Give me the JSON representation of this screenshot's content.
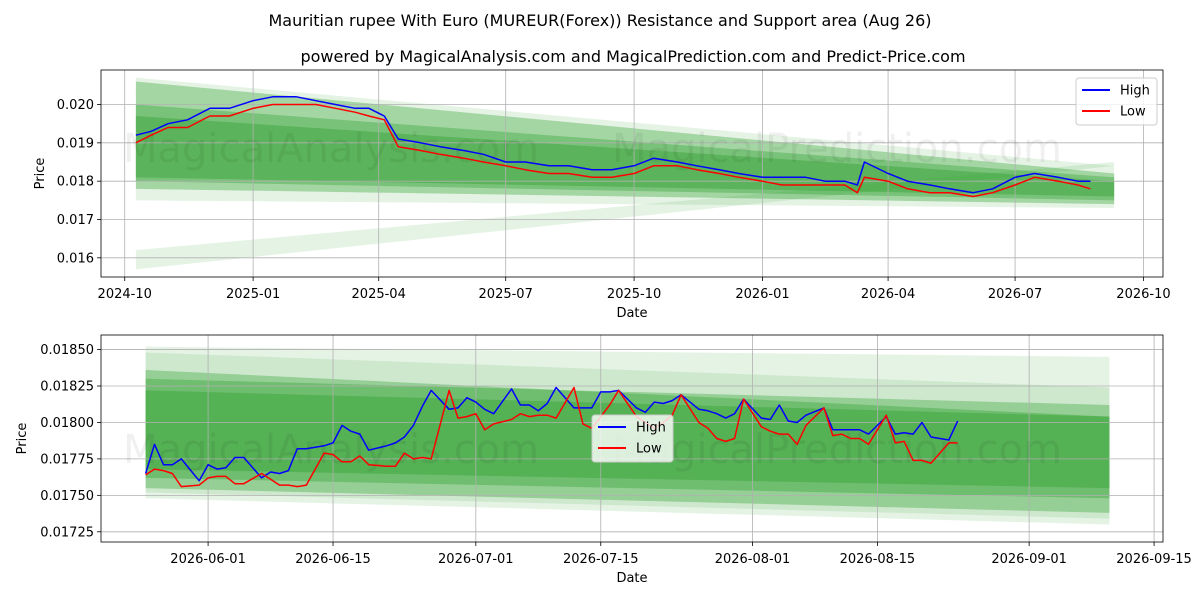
{
  "title": "Mauritian rupee With Euro (MUREUR(Forex)) Resistance and Support area (Aug 26)",
  "subtitle": "powered by MagicalAnalysis.com and MagicalPrediction.com and Predict-Price.com",
  "watermarks": [
    "MagicalAnalysis.com",
    "MagicalPrediction.com"
  ],
  "colors": {
    "high": "#0000ff",
    "low": "#ff0000",
    "band": "#2ca02c",
    "grid": "#b0b0b0"
  },
  "chart_data": [
    {
      "type": "line",
      "xlabel": "Date",
      "ylabel": "Price",
      "xlim": [
        "2024-09-14",
        "2026-10-15"
      ],
      "ylim": [
        0.0155,
        0.0209
      ],
      "x_ticks": [
        "2024-10",
        "2025-01",
        "2025-04",
        "2025-07",
        "2025-10",
        "2026-01",
        "2026-04",
        "2026-07",
        "2026-10"
      ],
      "y_ticks": [
        "0.016",
        "0.017",
        "0.018",
        "0.019",
        "0.020"
      ],
      "legend": {
        "position": "top-right",
        "entries": [
          "High",
          "Low"
        ]
      },
      "grid": true,
      "series": [
        {
          "name": "High",
          "x": [
            "2024-10-09",
            "2024-10-20",
            "2024-11-01",
            "2024-11-15",
            "2024-12-01",
            "2024-12-15",
            "2025-01-01",
            "2025-01-15",
            "2025-02-01",
            "2025-02-15",
            "2025-03-01",
            "2025-03-15",
            "2025-03-25",
            "2025-04-05",
            "2025-04-15",
            "2025-05-01",
            "2025-05-15",
            "2025-06-01",
            "2025-06-15",
            "2025-07-01",
            "2025-07-15",
            "2025-08-01",
            "2025-08-15",
            "2025-09-01",
            "2025-09-15",
            "2025-10-01",
            "2025-10-15",
            "2025-11-01",
            "2025-11-15",
            "2025-12-01",
            "2025-12-15",
            "2026-01-01",
            "2026-01-15",
            "2026-02-01",
            "2026-02-15",
            "2026-03-01",
            "2026-03-10",
            "2026-03-15",
            "2026-04-01",
            "2026-04-15",
            "2026-05-01",
            "2026-05-15",
            "2026-06-01",
            "2026-06-15",
            "2026-07-01",
            "2026-07-15",
            "2026-08-01",
            "2026-08-15",
            "2026-08-24"
          ],
          "values": [
            0.0192,
            0.0193,
            0.0195,
            0.0196,
            0.0199,
            0.0199,
            0.0201,
            0.0202,
            0.0202,
            0.0201,
            0.02,
            0.0199,
            0.0199,
            0.0197,
            0.0191,
            0.019,
            0.0189,
            0.0188,
            0.0187,
            0.0185,
            0.0185,
            0.0184,
            0.0184,
            0.0183,
            0.0183,
            0.0184,
            0.0186,
            0.0185,
            0.0184,
            0.0183,
            0.0182,
            0.0181,
            0.0181,
            0.0181,
            0.018,
            0.018,
            0.0179,
            0.0185,
            0.0182,
            0.018,
            0.0179,
            0.0178,
            0.0177,
            0.0178,
            0.0181,
            0.0182,
            0.0181,
            0.018,
            0.018
          ]
        },
        {
          "name": "Low",
          "x": [
            "2024-10-09",
            "2024-10-20",
            "2024-11-01",
            "2024-11-15",
            "2024-12-01",
            "2024-12-15",
            "2025-01-01",
            "2025-01-15",
            "2025-02-01",
            "2025-02-15",
            "2025-03-01",
            "2025-03-15",
            "2025-03-25",
            "2025-04-05",
            "2025-04-15",
            "2025-05-01",
            "2025-05-15",
            "2025-06-01",
            "2025-06-15",
            "2025-07-01",
            "2025-07-15",
            "2025-08-01",
            "2025-08-15",
            "2025-09-01",
            "2025-09-15",
            "2025-10-01",
            "2025-10-15",
            "2025-11-01",
            "2025-11-15",
            "2025-12-01",
            "2025-12-15",
            "2026-01-01",
            "2026-01-15",
            "2026-02-01",
            "2026-02-15",
            "2026-03-01",
            "2026-03-10",
            "2026-03-15",
            "2026-04-01",
            "2026-04-15",
            "2026-05-01",
            "2026-05-15",
            "2026-06-01",
            "2026-06-15",
            "2026-07-01",
            "2026-07-15",
            "2026-08-01",
            "2026-08-15",
            "2026-08-24"
          ],
          "values": [
            0.019,
            0.0192,
            0.0194,
            0.0194,
            0.0197,
            0.0197,
            0.0199,
            0.02,
            0.02,
            0.02,
            0.0199,
            0.0198,
            0.0197,
            0.0196,
            0.0189,
            0.0188,
            0.0187,
            0.0186,
            0.0185,
            0.0184,
            0.0183,
            0.0182,
            0.0182,
            0.0181,
            0.0181,
            0.0182,
            0.0184,
            0.0184,
            0.0183,
            0.0182,
            0.0181,
            0.018,
            0.0179,
            0.0179,
            0.0179,
            0.0179,
            0.0177,
            0.0181,
            0.018,
            0.0178,
            0.0177,
            0.0177,
            0.0176,
            0.0177,
            0.0179,
            0.0181,
            0.018,
            0.0179,
            0.0178
          ]
        }
      ],
      "bands": [
        {
          "x": [
            "2024-10-09",
            "2026-09-10"
          ],
          "upper": [
            0.0206,
            0.0182
          ],
          "lower": [
            0.0178,
            0.0174
          ],
          "opacity": 0.35
        },
        {
          "x": [
            "2024-10-09",
            "2026-09-10"
          ],
          "upper": [
            0.02,
            0.0181
          ],
          "lower": [
            0.018,
            0.0175
          ],
          "opacity": 0.35
        },
        {
          "x": [
            "2024-10-09",
            "2026-09-10"
          ],
          "upper": [
            0.0197,
            0.018
          ],
          "lower": [
            0.0181,
            0.0176
          ],
          "opacity": 0.4
        },
        {
          "x": [
            "2024-10-09",
            "2026-09-10"
          ],
          "upper": [
            0.0207,
            0.0184
          ],
          "lower": [
            0.0175,
            0.0173
          ],
          "opacity": 0.12
        },
        {
          "x": [
            "2024-10-09",
            "2026-09-10"
          ],
          "upper": [
            0.0162,
            0.0185
          ],
          "lower": [
            0.0157,
            0.0184
          ],
          "opacity": 0.12
        }
      ]
    },
    {
      "type": "line",
      "xlabel": "Date",
      "ylabel": "Price",
      "xlim": [
        "2026-05-20",
        "2026-09-16"
      ],
      "ylim": [
        0.01718,
        0.0186
      ],
      "x_ticks": [
        "2026-06-01",
        "2026-06-15",
        "2026-07-01",
        "2026-07-15",
        "2026-08-01",
        "2026-08-15",
        "2026-09-01",
        "2026-09-15"
      ],
      "y_ticks": [
        "0.01725",
        "0.01750",
        "0.01775",
        "0.01800",
        "0.01825",
        "0.01850"
      ],
      "legend": {
        "position": "center",
        "entries": [
          "High",
          "Low"
        ]
      },
      "grid": true,
      "series": [
        {
          "name": "High",
          "x": [
            "2026-05-25",
            "2026-05-26",
            "2026-05-27",
            "2026-05-28",
            "2026-05-29",
            "2026-05-31",
            "2026-06-01",
            "2026-06-02",
            "2026-06-03",
            "2026-06-04",
            "2026-06-05",
            "2026-06-07",
            "2026-06-08",
            "2026-06-09",
            "2026-06-10",
            "2026-06-11",
            "2026-06-12",
            "2026-06-14",
            "2026-06-15",
            "2026-06-16",
            "2026-06-17",
            "2026-06-18",
            "2026-06-19",
            "2026-06-21",
            "2026-06-22",
            "2026-06-23",
            "2026-06-24",
            "2026-06-25",
            "2026-06-26",
            "2026-06-28",
            "2026-06-29",
            "2026-06-30",
            "2026-07-01",
            "2026-07-02",
            "2026-07-03",
            "2026-07-05",
            "2026-07-06",
            "2026-07-07",
            "2026-07-08",
            "2026-07-09",
            "2026-07-10",
            "2026-07-12",
            "2026-07-13",
            "2026-07-14",
            "2026-07-15",
            "2026-07-16",
            "2026-07-17",
            "2026-07-19",
            "2026-07-20",
            "2026-07-21",
            "2026-07-22",
            "2026-07-23",
            "2026-07-24",
            "2026-07-26",
            "2026-07-27",
            "2026-07-28",
            "2026-07-29",
            "2026-07-30",
            "2026-07-31",
            "2026-08-02",
            "2026-08-03",
            "2026-08-04",
            "2026-08-05",
            "2026-08-06",
            "2026-08-07",
            "2026-08-09",
            "2026-08-10",
            "2026-08-11",
            "2026-08-12",
            "2026-08-13",
            "2026-08-14",
            "2026-08-16",
            "2026-08-17",
            "2026-08-18",
            "2026-08-19",
            "2026-08-20",
            "2026-08-21",
            "2026-08-23",
            "2026-08-24"
          ],
          "values": [
            0.01765,
            0.01785,
            0.01771,
            0.01771,
            0.01775,
            0.0176,
            0.01771,
            0.01768,
            0.01769,
            0.01776,
            0.01776,
            0.01762,
            0.01766,
            0.01765,
            0.01767,
            0.01782,
            0.01782,
            0.01784,
            0.01786,
            0.01798,
            0.01794,
            0.01792,
            0.01781,
            0.01784,
            0.01786,
            0.0179,
            0.01798,
            0.01811,
            0.01822,
            0.01809,
            0.0181,
            0.01817,
            0.01814,
            0.01809,
            0.01806,
            0.01823,
            0.01812,
            0.01812,
            0.01808,
            0.01813,
            0.01824,
            0.0181,
            0.0181,
            0.0181,
            0.01821,
            0.01821,
            0.01822,
            0.0181,
            0.01807,
            0.01814,
            0.01813,
            0.01815,
            0.01819,
            0.01809,
            0.01808,
            0.01806,
            0.01803,
            0.01806,
            0.01816,
            0.01803,
            0.01802,
            0.01812,
            0.01801,
            0.018,
            0.01805,
            0.0181,
            0.01795,
            0.01795,
            0.01795,
            0.01795,
            0.01792,
            0.01804,
            0.01792,
            0.01793,
            0.01792,
            0.018,
            0.0179,
            0.01788,
            0.01801
          ]
        },
        {
          "name": "Low",
          "x": [
            "2026-05-25",
            "2026-05-26",
            "2026-05-27",
            "2026-05-28",
            "2026-05-29",
            "2026-05-31",
            "2026-06-01",
            "2026-06-02",
            "2026-06-03",
            "2026-06-04",
            "2026-06-05",
            "2026-06-07",
            "2026-06-08",
            "2026-06-09",
            "2026-06-10",
            "2026-06-11",
            "2026-06-12",
            "2026-06-14",
            "2026-06-15",
            "2026-06-16",
            "2026-06-17",
            "2026-06-18",
            "2026-06-19",
            "2026-06-21",
            "2026-06-22",
            "2026-06-23",
            "2026-06-24",
            "2026-06-25",
            "2026-06-26",
            "2026-06-28",
            "2026-06-29",
            "2026-06-30",
            "2026-07-01",
            "2026-07-02",
            "2026-07-03",
            "2026-07-05",
            "2026-07-06",
            "2026-07-07",
            "2026-07-08",
            "2026-07-09",
            "2026-07-10",
            "2026-07-12",
            "2026-07-13",
            "2026-07-14",
            "2026-07-15",
            "2026-07-16",
            "2026-07-17",
            "2026-07-19",
            "2026-07-20",
            "2026-07-21",
            "2026-07-22",
            "2026-07-23",
            "2026-07-24",
            "2026-07-26",
            "2026-07-27",
            "2026-07-28",
            "2026-07-29",
            "2026-07-30",
            "2026-07-31",
            "2026-08-02",
            "2026-08-03",
            "2026-08-04",
            "2026-08-05",
            "2026-08-06",
            "2026-08-07",
            "2026-08-09",
            "2026-08-10",
            "2026-08-11",
            "2026-08-12",
            "2026-08-13",
            "2026-08-14",
            "2026-08-16",
            "2026-08-17",
            "2026-08-18",
            "2026-08-19",
            "2026-08-20",
            "2026-08-21",
            "2026-08-23",
            "2026-08-24"
          ],
          "values": [
            0.01764,
            0.01768,
            0.01767,
            0.01765,
            0.01756,
            0.01757,
            0.01762,
            0.01763,
            0.01763,
            0.01758,
            0.01758,
            0.01765,
            0.01761,
            0.01757,
            0.01757,
            0.01756,
            0.01757,
            0.01779,
            0.01778,
            0.01773,
            0.01773,
            0.01777,
            0.01771,
            0.0177,
            0.0177,
            0.01779,
            0.01775,
            0.01776,
            0.01775,
            0.01822,
            0.01803,
            0.01804,
            0.01806,
            0.01795,
            0.01799,
            0.01802,
            0.01806,
            0.01804,
            0.01805,
            0.01805,
            0.01803,
            0.01824,
            0.01799,
            0.01796,
            0.01804,
            0.01812,
            0.01822,
            0.01804,
            0.018,
            0.01796,
            0.018,
            0.01805,
            0.01819,
            0.018,
            0.01796,
            0.01789,
            0.01787,
            0.01789,
            0.01816,
            0.01797,
            0.01794,
            0.01792,
            0.01792,
            0.01785,
            0.01798,
            0.0181,
            0.01791,
            0.01792,
            0.01789,
            0.01789,
            0.01785,
            0.01805,
            0.01786,
            0.01787,
            0.01774,
            0.01774,
            0.01772,
            0.01786,
            0.01786
          ]
        }
      ],
      "bands": [
        {
          "x": [
            "2026-05-25",
            "2026-09-10"
          ],
          "upper": [
            0.01836,
            0.01804
          ],
          "lower": [
            0.01755,
            0.01738
          ],
          "opacity": 0.35
        },
        {
          "x": [
            "2026-05-25",
            "2026-09-10"
          ],
          "upper": [
            0.0183,
            0.01812
          ],
          "lower": [
            0.01762,
            0.01748
          ],
          "opacity": 0.35
        },
        {
          "x": [
            "2026-05-25",
            "2026-09-10"
          ],
          "upper": [
            0.01822,
            0.01804
          ],
          "lower": [
            0.01768,
            0.01755
          ],
          "opacity": 0.4
        },
        {
          "x": [
            "2026-05-25",
            "2026-09-10"
          ],
          "upper": [
            0.01852,
            0.01845
          ],
          "lower": [
            0.01748,
            0.0173
          ],
          "opacity": 0.12
        },
        {
          "x": [
            "2026-05-25",
            "2026-09-10"
          ],
          "upper": [
            0.01848,
            0.01824
          ],
          "lower": [
            0.01752,
            0.01734
          ],
          "opacity": 0.12
        }
      ]
    }
  ]
}
